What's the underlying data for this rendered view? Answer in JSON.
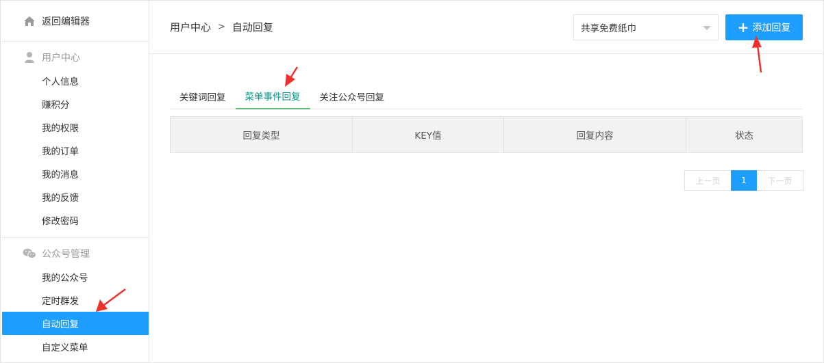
{
  "sidebar": {
    "back_label": "返回编辑器",
    "user_center": {
      "title": "用户中心",
      "items": [
        "个人信息",
        "赚积分",
        "我的权限",
        "我的订单",
        "我的消息",
        "我的反馈",
        "修改密码"
      ]
    },
    "mp_manage": {
      "title": "公众号管理",
      "items": [
        "我的公众号",
        "定时群发",
        "自动回复",
        "自定义菜单"
      ],
      "active_index": 2
    }
  },
  "header": {
    "breadcrumb": [
      "用户中心",
      "自动回复"
    ],
    "breadcrumb_sep": ">",
    "select_value": "共享免费纸巾",
    "add_button": "添加回复"
  },
  "tabs": [
    "关键词回复",
    "菜单事件回复",
    "关注公众号回复"
  ],
  "active_tab": 1,
  "table": {
    "headers": [
      "回复类型",
      "KEY值",
      "回复内容",
      "状态"
    ]
  },
  "pagination": {
    "prev": "上一页",
    "current": "1",
    "next": "下一页"
  },
  "colors": {
    "primary": "#1e9fff",
    "tab_active_text": "#009688",
    "tab_active_border": "#5fb878",
    "annotation_arrow": "#f0312b"
  }
}
